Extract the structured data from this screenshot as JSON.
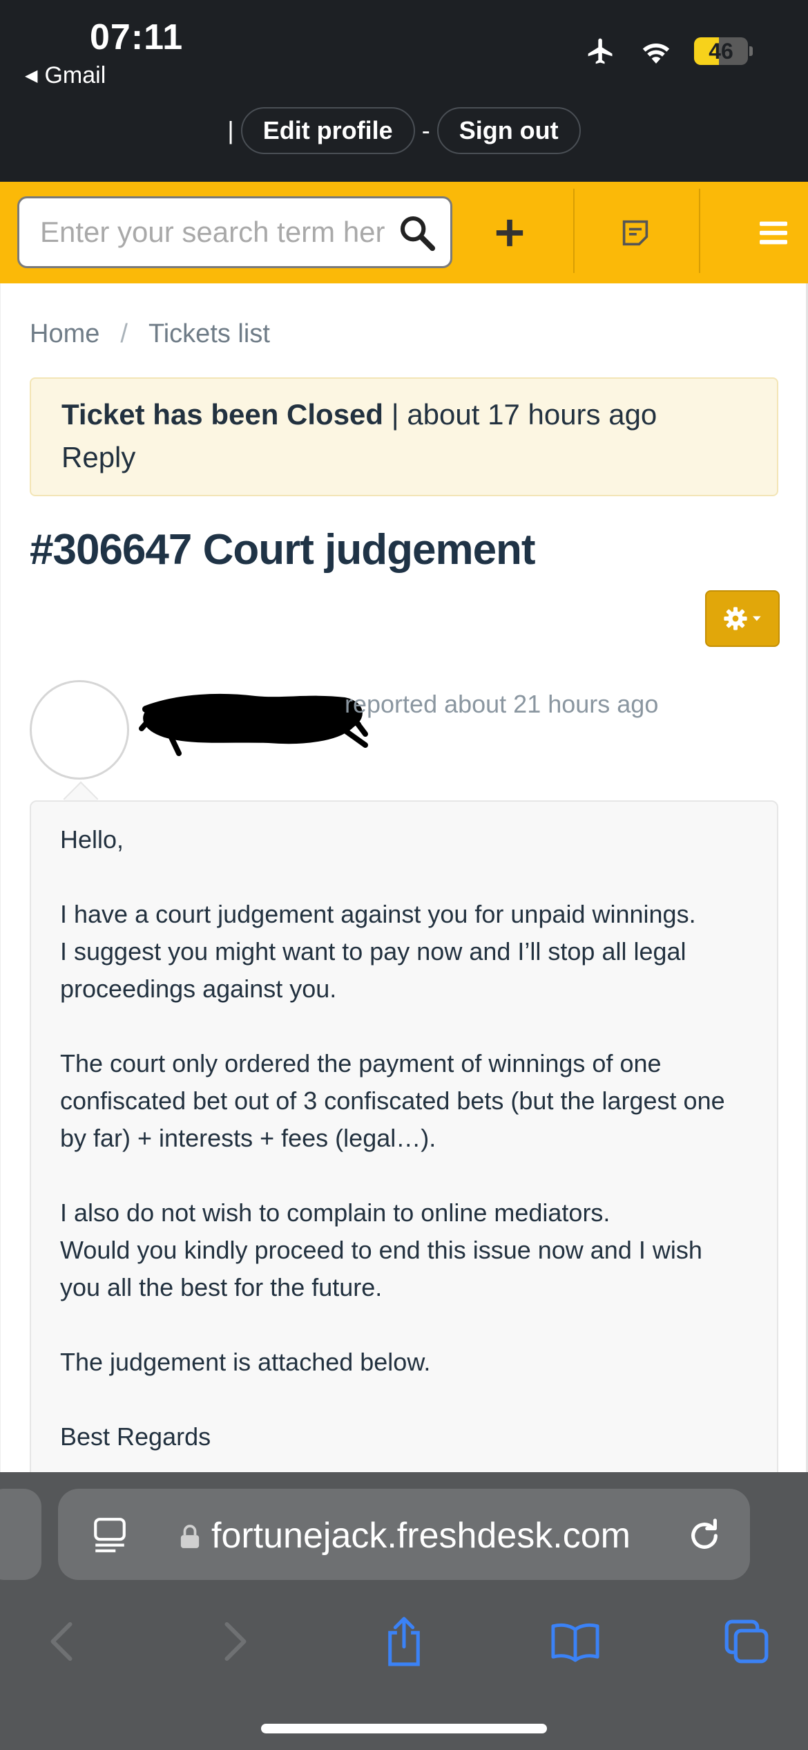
{
  "status_bar": {
    "time": "07:11",
    "back_app": "Gmail",
    "battery": "46",
    "battery_level": 0.46
  },
  "account": {
    "separator_left": "|",
    "edit_profile": "Edit profile",
    "separator_mid": "-",
    "sign_out": "Sign out"
  },
  "toolbar": {
    "search_placeholder": "Enter your search term here...",
    "icons": [
      "search-icon",
      "plus-icon",
      "ticket-icon",
      "menu-icon"
    ]
  },
  "breadcrumb": {
    "home": "Home",
    "separator": "/",
    "tickets": "Tickets list"
  },
  "notice": {
    "status": "Ticket has been Closed",
    "separator": "|",
    "time": "about 17 hours ago",
    "reply": "Reply"
  },
  "ticket": {
    "title": "#306647 Court judgement",
    "reported": "reported about 21 hours ago",
    "message": [
      "Hello,",
      "I have a court judgement against you for unpaid winnings.\nI suggest you might want to pay now and I’ll stop all legal proceedings against you.",
      "The court only ordered the payment of winnings of one confiscated bet out of 3 confiscated bets (but the largest one by far) + interests + fees (legal…).",
      "I also do not wish to complain to online mediators.\nWould you kindly proceed to end this issue now and I wish you all the best for the future.",
      "The judgement is attached below.",
      "Best Regards"
    ]
  },
  "browser": {
    "url": "fortunejack.freshdesk.com"
  },
  "colors": {
    "toolbar_yellow": "#fbb908",
    "header_dark": "#1d2024",
    "gear_button": "#e1a70a",
    "notice_bg": "#fcf6e2",
    "title_color": "#1f3346",
    "safari_blue": "#3b82f6"
  }
}
